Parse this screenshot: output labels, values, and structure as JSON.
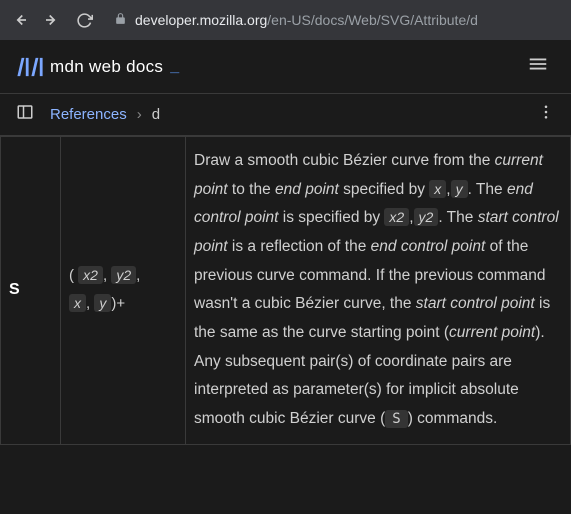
{
  "browser": {
    "url_domain": "developer.mozilla.org",
    "url_path": "/en-US/docs/Web/SVG/Attribute/d"
  },
  "header": {
    "logo_text": "mdn web docs",
    "cursor": "_"
  },
  "breadcrumb": {
    "parent": "References",
    "separator": "›",
    "current": "d"
  },
  "table": {
    "command": "S",
    "params": {
      "open": "(",
      "x2": "x2",
      "y2": "y2",
      "comma1": ",",
      "comma2": ",",
      "x": "x",
      "y": "y",
      "comma3": ",",
      "close": ")+"
    },
    "desc": {
      "t1": "Draw a smooth cubic Bézier curve from the ",
      "i1": "current point",
      "t2": " to the ",
      "i2": "end point",
      "t3": " specified by ",
      "vx": "x",
      "vy": "y",
      "t4": ". The ",
      "i3": "end control point",
      "t5": " is specified by ",
      "vx2": "x2",
      "vy2": "y2",
      "t6": ". The ",
      "i4": "start control point",
      "t7": " is a reflection of the ",
      "i5": "end control point",
      "t8": " of the previous curve command. If the previous command wasn't a cubic Bézier curve, the ",
      "i6": "start control point",
      "t9": " is the same as the curve starting point (",
      "i7": "current point",
      "t10": "). Any subsequent pair(s) of coordinate pairs are interpreted as parameter(s) for implicit absolute smooth cubic Bézier curve (",
      "codeS": "S",
      "t11": ") commands.",
      "comma": ","
    }
  }
}
